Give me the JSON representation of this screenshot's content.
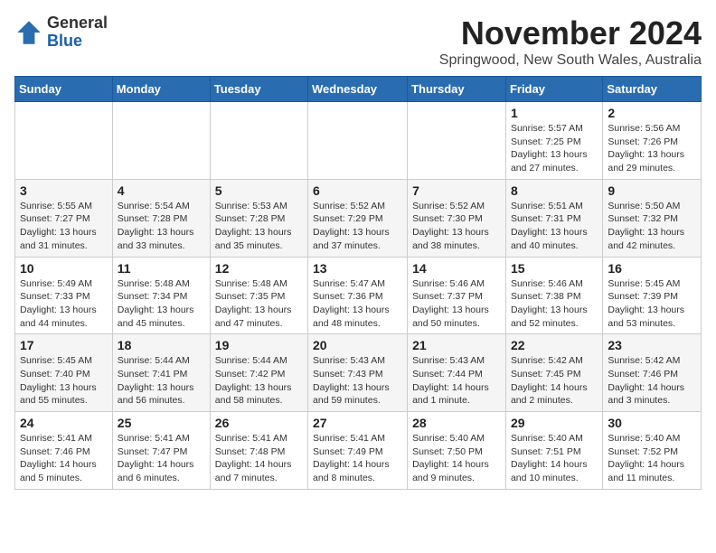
{
  "header": {
    "logo_general": "General",
    "logo_blue": "Blue",
    "month_title": "November 2024",
    "location": "Springwood, New South Wales, Australia"
  },
  "weekdays": [
    "Sunday",
    "Monday",
    "Tuesday",
    "Wednesday",
    "Thursday",
    "Friday",
    "Saturday"
  ],
  "weeks": [
    [
      {
        "day": "",
        "info": ""
      },
      {
        "day": "",
        "info": ""
      },
      {
        "day": "",
        "info": ""
      },
      {
        "day": "",
        "info": ""
      },
      {
        "day": "",
        "info": ""
      },
      {
        "day": "1",
        "info": "Sunrise: 5:57 AM\nSunset: 7:25 PM\nDaylight: 13 hours and 27 minutes."
      },
      {
        "day": "2",
        "info": "Sunrise: 5:56 AM\nSunset: 7:26 PM\nDaylight: 13 hours and 29 minutes."
      }
    ],
    [
      {
        "day": "3",
        "info": "Sunrise: 5:55 AM\nSunset: 7:27 PM\nDaylight: 13 hours and 31 minutes."
      },
      {
        "day": "4",
        "info": "Sunrise: 5:54 AM\nSunset: 7:28 PM\nDaylight: 13 hours and 33 minutes."
      },
      {
        "day": "5",
        "info": "Sunrise: 5:53 AM\nSunset: 7:28 PM\nDaylight: 13 hours and 35 minutes."
      },
      {
        "day": "6",
        "info": "Sunrise: 5:52 AM\nSunset: 7:29 PM\nDaylight: 13 hours and 37 minutes."
      },
      {
        "day": "7",
        "info": "Sunrise: 5:52 AM\nSunset: 7:30 PM\nDaylight: 13 hours and 38 minutes."
      },
      {
        "day": "8",
        "info": "Sunrise: 5:51 AM\nSunset: 7:31 PM\nDaylight: 13 hours and 40 minutes."
      },
      {
        "day": "9",
        "info": "Sunrise: 5:50 AM\nSunset: 7:32 PM\nDaylight: 13 hours and 42 minutes."
      }
    ],
    [
      {
        "day": "10",
        "info": "Sunrise: 5:49 AM\nSunset: 7:33 PM\nDaylight: 13 hours and 44 minutes."
      },
      {
        "day": "11",
        "info": "Sunrise: 5:48 AM\nSunset: 7:34 PM\nDaylight: 13 hours and 45 minutes."
      },
      {
        "day": "12",
        "info": "Sunrise: 5:48 AM\nSunset: 7:35 PM\nDaylight: 13 hours and 47 minutes."
      },
      {
        "day": "13",
        "info": "Sunrise: 5:47 AM\nSunset: 7:36 PM\nDaylight: 13 hours and 48 minutes."
      },
      {
        "day": "14",
        "info": "Sunrise: 5:46 AM\nSunset: 7:37 PM\nDaylight: 13 hours and 50 minutes."
      },
      {
        "day": "15",
        "info": "Sunrise: 5:46 AM\nSunset: 7:38 PM\nDaylight: 13 hours and 52 minutes."
      },
      {
        "day": "16",
        "info": "Sunrise: 5:45 AM\nSunset: 7:39 PM\nDaylight: 13 hours and 53 minutes."
      }
    ],
    [
      {
        "day": "17",
        "info": "Sunrise: 5:45 AM\nSunset: 7:40 PM\nDaylight: 13 hours and 55 minutes."
      },
      {
        "day": "18",
        "info": "Sunrise: 5:44 AM\nSunset: 7:41 PM\nDaylight: 13 hours and 56 minutes."
      },
      {
        "day": "19",
        "info": "Sunrise: 5:44 AM\nSunset: 7:42 PM\nDaylight: 13 hours and 58 minutes."
      },
      {
        "day": "20",
        "info": "Sunrise: 5:43 AM\nSunset: 7:43 PM\nDaylight: 13 hours and 59 minutes."
      },
      {
        "day": "21",
        "info": "Sunrise: 5:43 AM\nSunset: 7:44 PM\nDaylight: 14 hours and 1 minute."
      },
      {
        "day": "22",
        "info": "Sunrise: 5:42 AM\nSunset: 7:45 PM\nDaylight: 14 hours and 2 minutes."
      },
      {
        "day": "23",
        "info": "Sunrise: 5:42 AM\nSunset: 7:46 PM\nDaylight: 14 hours and 3 minutes."
      }
    ],
    [
      {
        "day": "24",
        "info": "Sunrise: 5:41 AM\nSunset: 7:46 PM\nDaylight: 14 hours and 5 minutes."
      },
      {
        "day": "25",
        "info": "Sunrise: 5:41 AM\nSunset: 7:47 PM\nDaylight: 14 hours and 6 minutes."
      },
      {
        "day": "26",
        "info": "Sunrise: 5:41 AM\nSunset: 7:48 PM\nDaylight: 14 hours and 7 minutes."
      },
      {
        "day": "27",
        "info": "Sunrise: 5:41 AM\nSunset: 7:49 PM\nDaylight: 14 hours and 8 minutes."
      },
      {
        "day": "28",
        "info": "Sunrise: 5:40 AM\nSunset: 7:50 PM\nDaylight: 14 hours and 9 minutes."
      },
      {
        "day": "29",
        "info": "Sunrise: 5:40 AM\nSunset: 7:51 PM\nDaylight: 14 hours and 10 minutes."
      },
      {
        "day": "30",
        "info": "Sunrise: 5:40 AM\nSunset: 7:52 PM\nDaylight: 14 hours and 11 minutes."
      }
    ]
  ]
}
